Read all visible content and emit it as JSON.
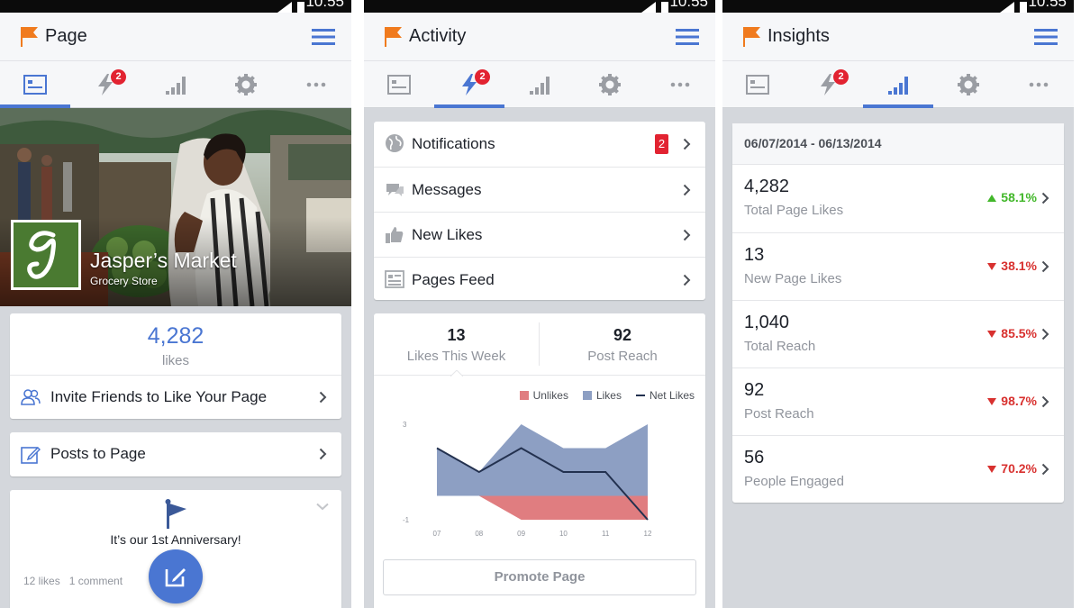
{
  "status": {
    "time": "10:55"
  },
  "colors": {
    "accent": "#4a76d2",
    "badge": "#e22331",
    "up": "#42b72a",
    "down": "#d8312f",
    "flag": "#f07b1e"
  },
  "screens": {
    "page": {
      "title": "Page",
      "tabs": [
        {
          "icon": "news-feed-icon",
          "active": true
        },
        {
          "icon": "activity-bolt-icon",
          "badge": "2"
        },
        {
          "icon": "insights-bars-icon"
        },
        {
          "icon": "gear-icon"
        },
        {
          "icon": "more-dots-icon"
        }
      ],
      "cover": {
        "name": "Jasper’s Market",
        "category": "Grocery Store",
        "logo_letter": "J"
      },
      "likes_count": "4,282",
      "likes_label": "likes",
      "invite_label": "Invite Friends to Like Your Page",
      "posts_label": "Posts to Page",
      "post": {
        "text": "It’s our 1st Anniversary!",
        "stats": "12 likes   1 comment"
      }
    },
    "activity": {
      "title": "Activity",
      "list": [
        {
          "label": "Notifications",
          "icon": "globe-icon",
          "badge": "2"
        },
        {
          "label": "Messages",
          "icon": "chat-bubble-icon"
        },
        {
          "label": "New Likes",
          "icon": "thumbs-up-icon"
        },
        {
          "label": "Pages Feed",
          "icon": "feed-list-icon"
        }
      ],
      "stats": [
        {
          "value": "13",
          "label": "Likes This Week"
        },
        {
          "value": "92",
          "label": "Post Reach"
        }
      ],
      "promote_label": "Promote Page"
    },
    "insights": {
      "title": "Insights",
      "date_range": "06/07/2014 - 06/13/2014",
      "rows": [
        {
          "value": "4,282",
          "label": "Total Page Likes",
          "change": "58.1%",
          "direction": "up"
        },
        {
          "value": "13",
          "label": "New Page Likes",
          "change": "38.1%",
          "direction": "down"
        },
        {
          "value": "1,040",
          "label": "Total Reach",
          "change": "85.5%",
          "direction": "down"
        },
        {
          "value": "92",
          "label": "Post Reach",
          "change": "98.7%",
          "direction": "down"
        },
        {
          "value": "56",
          "label": "People Engaged",
          "change": "70.2%",
          "direction": "down"
        }
      ]
    }
  },
  "chart_data": {
    "type": "area",
    "x": [
      "07",
      "08",
      "09",
      "10",
      "11",
      "12"
    ],
    "ylim": [
      -1,
      3
    ],
    "yticks": [
      "3",
      "-1"
    ],
    "legend_position": "top-right",
    "series": [
      {
        "name": "Unlikes",
        "color": "#e07d80",
        "values": [
          0,
          0,
          -1,
          -1,
          -1,
          -1
        ]
      },
      {
        "name": "Likes",
        "color": "#8d9fc3",
        "values": [
          2,
          1,
          3,
          2,
          2,
          3
        ]
      },
      {
        "name": "Net Likes",
        "color": "#23314f",
        "values": [
          2,
          1,
          2,
          1,
          1,
          -1
        ]
      }
    ]
  }
}
